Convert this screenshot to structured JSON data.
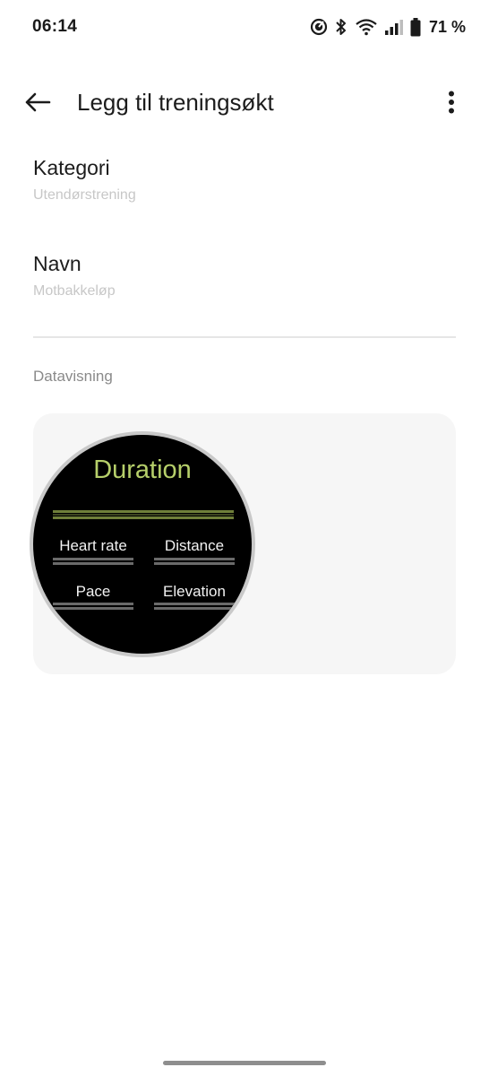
{
  "status_bar": {
    "time": "06:14",
    "battery": "71 %",
    "icons": [
      "gps-target-icon",
      "bluetooth-icon",
      "wifi-icon",
      "signal-icon",
      "battery-icon"
    ]
  },
  "app_bar": {
    "title": "Legg til treningsøkt",
    "back_icon": "arrow-back-icon",
    "more_icon": "more-vert-icon"
  },
  "form": {
    "category": {
      "label": "Kategori",
      "value": "Utendørstrening"
    },
    "name": {
      "label": "Navn",
      "value": "Motbakkeløp"
    }
  },
  "data_view": {
    "section_label": "Datavisning",
    "watch": {
      "title": "Duration",
      "fields": [
        "Heart rate",
        "Distance",
        "Pace",
        "Elevation"
      ],
      "title_color": "#b6cf6a"
    }
  }
}
